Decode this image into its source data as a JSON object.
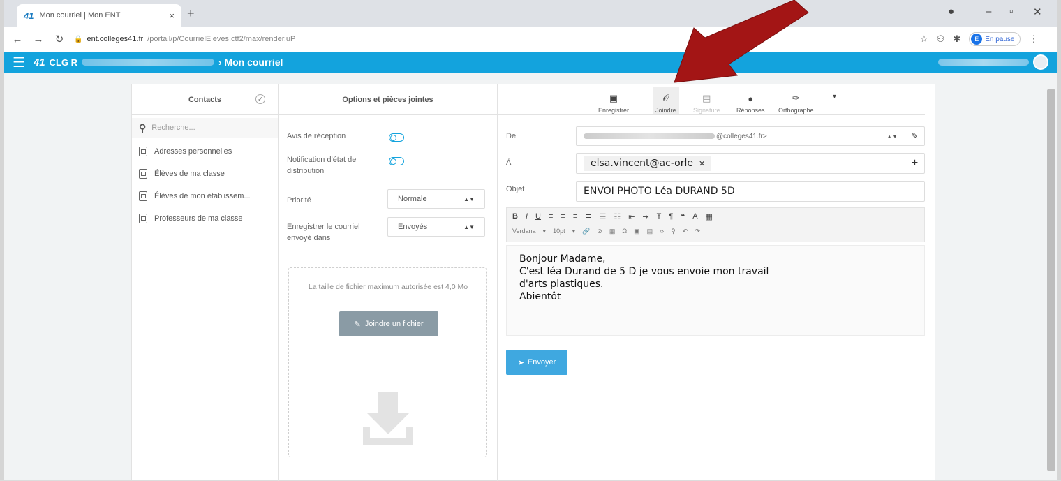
{
  "browser": {
    "tab_logo": "41",
    "tab_title": "Mon courriel | Mon ENT",
    "tab_close": "×",
    "new_tab": "+",
    "url_host": "ent.colleges41.fr",
    "url_path": "/portail/p/CourrielEleves.ctf2/max/render.uP",
    "profile_label": "En pause",
    "profile_initial": "E"
  },
  "header": {
    "logo": "41",
    "school_prefix": "CLG R",
    "separator": "›",
    "page_title": "Mon courriel"
  },
  "contacts": {
    "title": "Contacts",
    "search_placeholder": "Recherche...",
    "items": [
      {
        "label": "Adresses personnelles"
      },
      {
        "label": "Élèves de ma classe"
      },
      {
        "label": "Élèves de mon établissem..."
      },
      {
        "label": "Professeurs de ma classe"
      }
    ]
  },
  "options": {
    "title": "Options et pièces jointes",
    "read_receipt_label": "Avis de réception",
    "delivery_notif_label": "Notification d'état de distribution",
    "priority_label": "Priorité",
    "priority_value": "Normale",
    "save_in_label": "Enregistrer le courriel envoyé dans",
    "save_in_value": "Envoyés",
    "max_size_text": "La taille de fichier maximum autorisée est 4,0 Mo",
    "attach_button": "Joindre un fichier"
  },
  "toolbar": {
    "save": "Enregistrer",
    "attach": "Joindre",
    "signature": "Signature",
    "replies": "Réponses",
    "spelling": "Orthographe"
  },
  "compose": {
    "from_label": "De",
    "from_value_suffix": "@colleges41.fr>",
    "to_label": "À",
    "to_recipient": "elsa.vincent@ac-orle",
    "subject_label": "Objet",
    "subject_value": "ENVOI PHOTO Léa DURAND 5D",
    "font_name": "Verdana",
    "font_size": "10pt",
    "body_lines": [
      "Bonjour Madame,",
      "C'est léa Durand de 5 D je vous envoie mon travail",
      "d'arts plastiques.",
      "Abientôt"
    ],
    "send_button": "Envoyer"
  },
  "colors": {
    "header_blue": "#13a3dd",
    "send_blue": "#3fa8e0",
    "attach_grey": "#8a9ba5",
    "arrow_red": "#a31515"
  }
}
